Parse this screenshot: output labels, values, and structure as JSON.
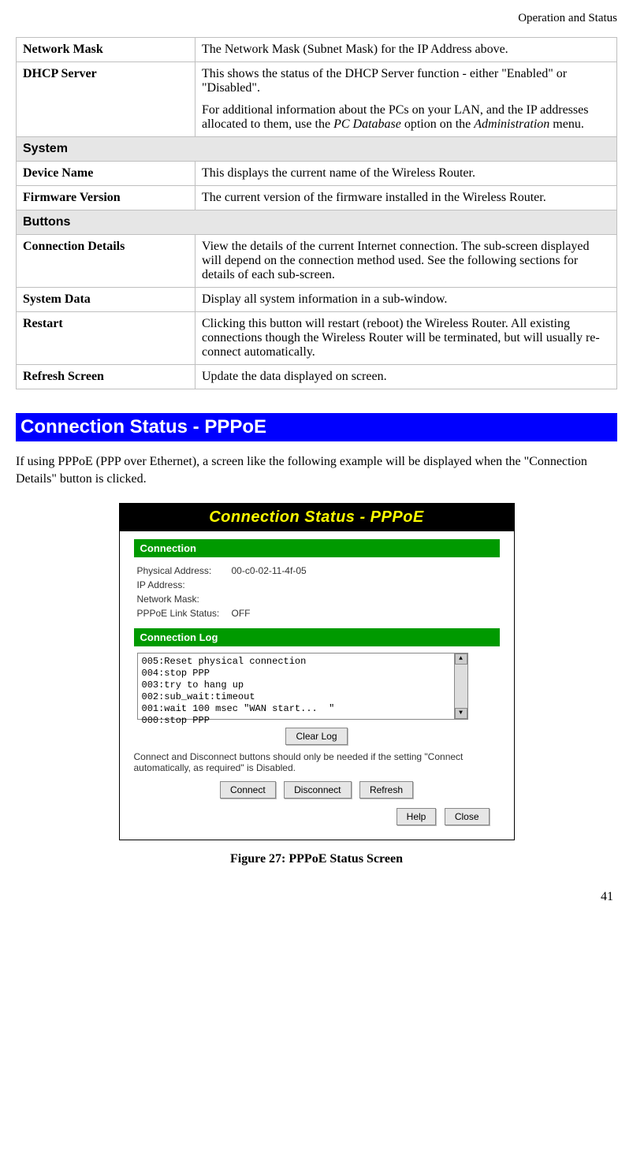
{
  "header": {
    "section": "Operation and Status"
  },
  "table": {
    "rows": [
      {
        "label": "Network Mask",
        "desc": "The Network Mask (Subnet Mask) for the IP Address above."
      },
      {
        "label": "DHCP Server",
        "desc_p1": "This shows the status of the DHCP Server function - either \"Enabled\" or \"Disabled\".",
        "desc_p2_a": "For additional information about the PCs on your LAN, and the IP addresses allocated to them, use the ",
        "desc_p2_em1": "PC Database",
        "desc_p2_b": " option on the ",
        "desc_p2_em2": "Administration",
        "desc_p2_c": " menu."
      }
    ],
    "section_system": "System",
    "system_rows": [
      {
        "label": "Device Name",
        "desc": "This displays the current name of the Wireless Router."
      },
      {
        "label": "Firmware Version",
        "desc": "The current version of the firmware installed in the Wireless Router."
      }
    ],
    "section_buttons": "Buttons",
    "button_rows": [
      {
        "label": "Connection Details",
        "desc": "View the details of the current Internet connection. The sub-screen displayed will depend on the connection method used. See the following sections for details of each sub-screen."
      },
      {
        "label": "System Data",
        "desc": "Display all system information in a sub-window."
      },
      {
        "label": "Restart",
        "desc": "Clicking this button will restart (reboot) the Wireless Router. All existing connections though the Wireless Router will be terminated, but will usually re-connect automatically."
      },
      {
        "label": "Refresh Screen",
        "desc": "Update the data displayed on screen."
      }
    ]
  },
  "heading": "Connection Status - PPPoE",
  "intro": "If using PPPoE (PPP over Ethernet), a screen like the following example will be displayed when the \"Connection Details\" button is clicked.",
  "screenshot": {
    "title": "Connection Status - PPPoE",
    "sec_connection": "Connection",
    "fields": {
      "physical_label": "Physical Address:",
      "physical_value": "00-c0-02-11-4f-05",
      "ip_label": "IP Address:",
      "ip_value": "",
      "mask_label": "Network Mask:",
      "mask_value": "",
      "link_label": "PPPoE Link Status:",
      "link_value": "OFF"
    },
    "sec_log": "Connection Log",
    "log": "005:Reset physical connection\n004:stop PPP\n003:try to hang up\n002:sub_wait:timeout\n001:wait 100 msec \"WAN start...  \"\n000:stop PPP",
    "clear_log": "Clear Log",
    "note": "Connect and Disconnect buttons should only be needed if the setting \"Connect automatically, as required\" is Disabled.",
    "btn_connect": "Connect",
    "btn_disconnect": "Disconnect",
    "btn_refresh": "Refresh",
    "btn_help": "Help",
    "btn_close": "Close"
  },
  "figure_caption": "Figure 27: PPPoE Status Screen",
  "page_number": "41"
}
